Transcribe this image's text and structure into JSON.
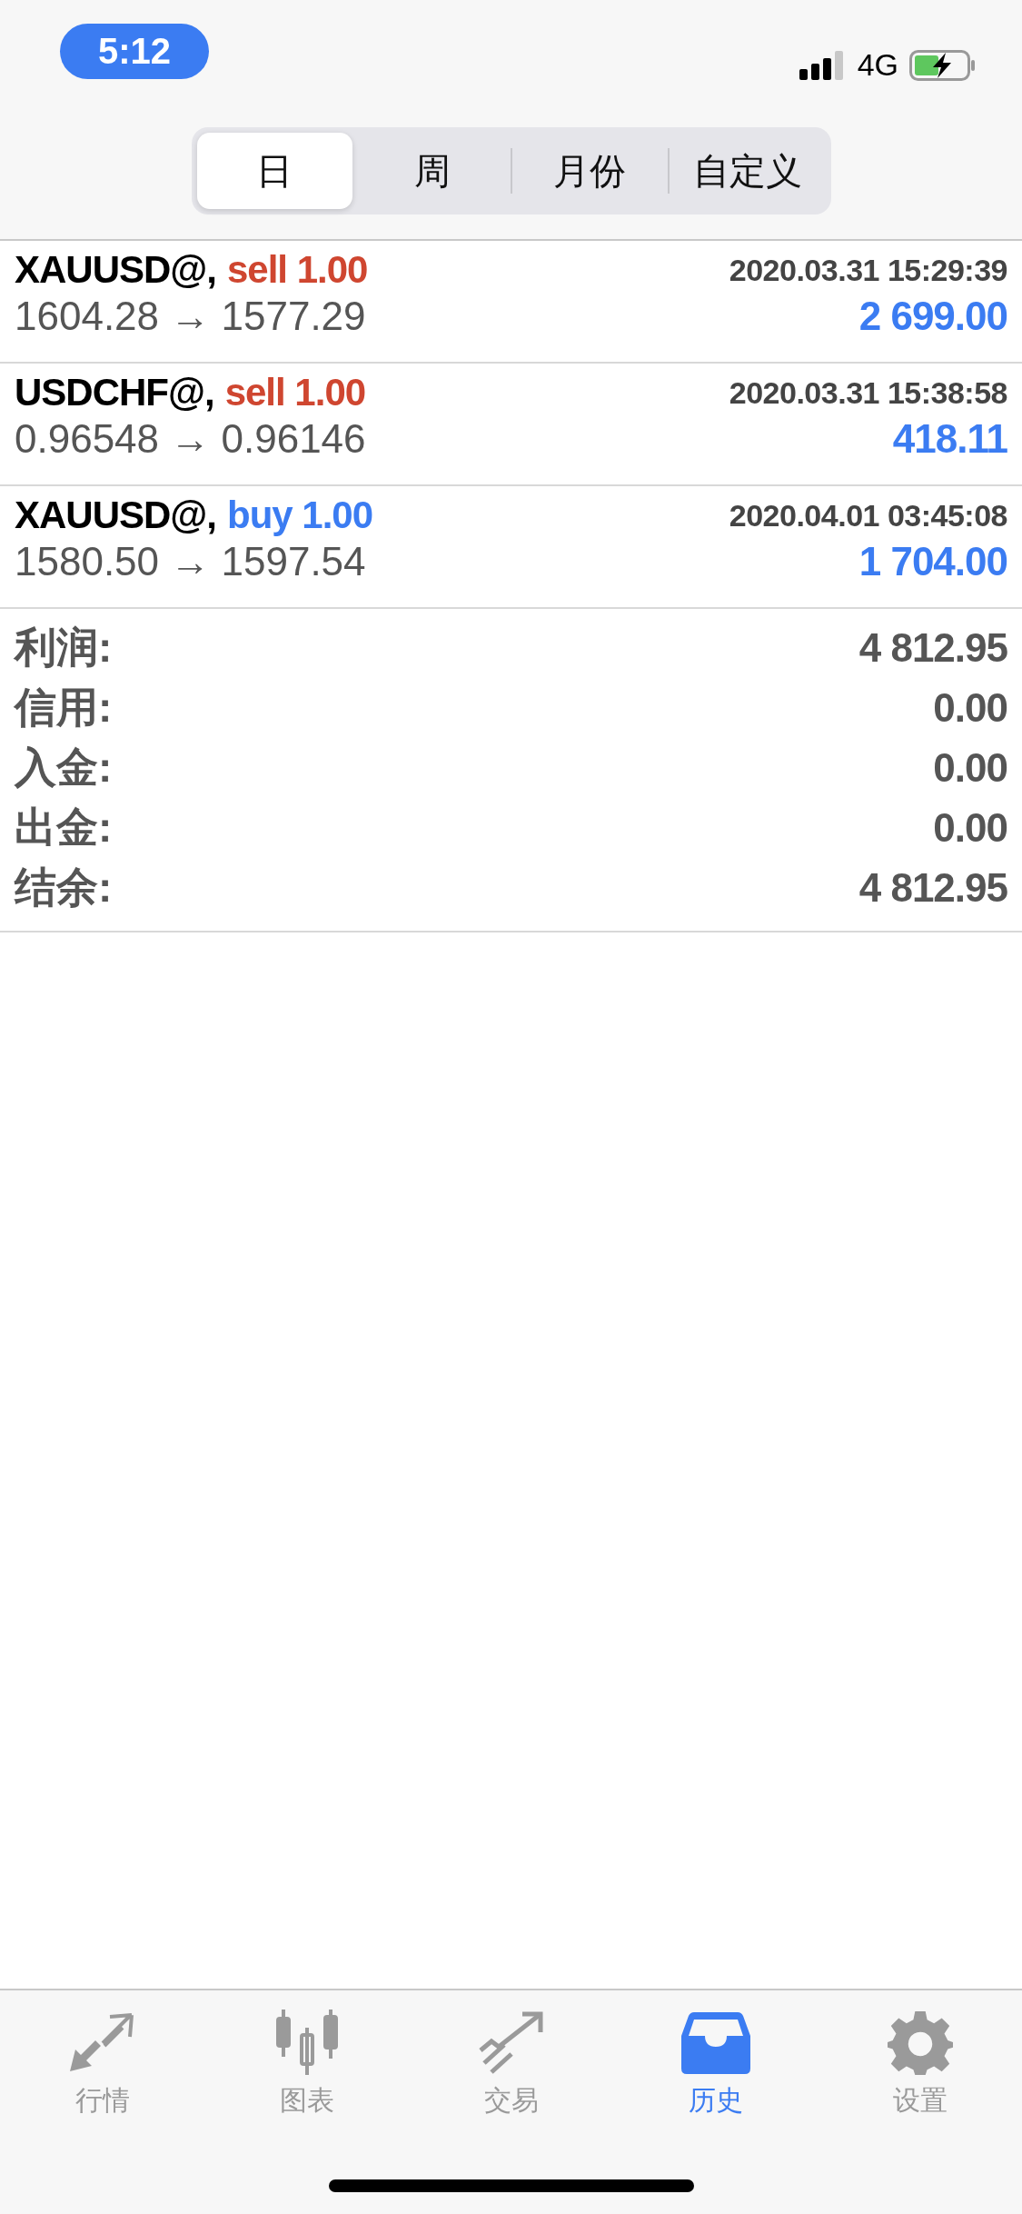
{
  "status_bar": {
    "time": "5:12",
    "network": "4G"
  },
  "period_tabs": [
    {
      "label": "日",
      "selected": true
    },
    {
      "label": "周",
      "selected": false
    },
    {
      "label": "月份",
      "selected": false
    },
    {
      "label": "自定义",
      "selected": false
    }
  ],
  "deals": [
    {
      "symbol": "XAUUSD@,",
      "kind": "sell",
      "order": "sell 1.00",
      "time": "2020.03.31 15:29:39",
      "prices": "1604.28 → 1577.29",
      "profit": "2 699.00"
    },
    {
      "symbol": "USDCHF@,",
      "kind": "sell",
      "order": "sell 1.00",
      "time": "2020.03.31 15:38:58",
      "prices": "0.96548 → 0.96146",
      "profit": "418.11"
    },
    {
      "symbol": "XAUUSD@,",
      "kind": "buy",
      "order": "buy 1.00",
      "time": "2020.04.01 03:45:08",
      "prices": "1580.50 → 1597.54",
      "profit": "1 704.00"
    }
  ],
  "summary": [
    {
      "label": "利润:",
      "value": "4 812.95"
    },
    {
      "label": "信用:",
      "value": "0.00"
    },
    {
      "label": "入金:",
      "value": "0.00"
    },
    {
      "label": "出金:",
      "value": "0.00"
    },
    {
      "label": "结余:",
      "value": "4 812.95"
    }
  ],
  "tab_bar": [
    {
      "kind": "quotes",
      "label": "行情",
      "selected": false
    },
    {
      "kind": "chart",
      "label": "图表",
      "selected": false
    },
    {
      "kind": "trade",
      "label": "交易",
      "selected": false
    },
    {
      "kind": "history",
      "label": "历史",
      "selected": true
    },
    {
      "kind": "settings",
      "label": "设置",
      "selected": false
    }
  ]
}
